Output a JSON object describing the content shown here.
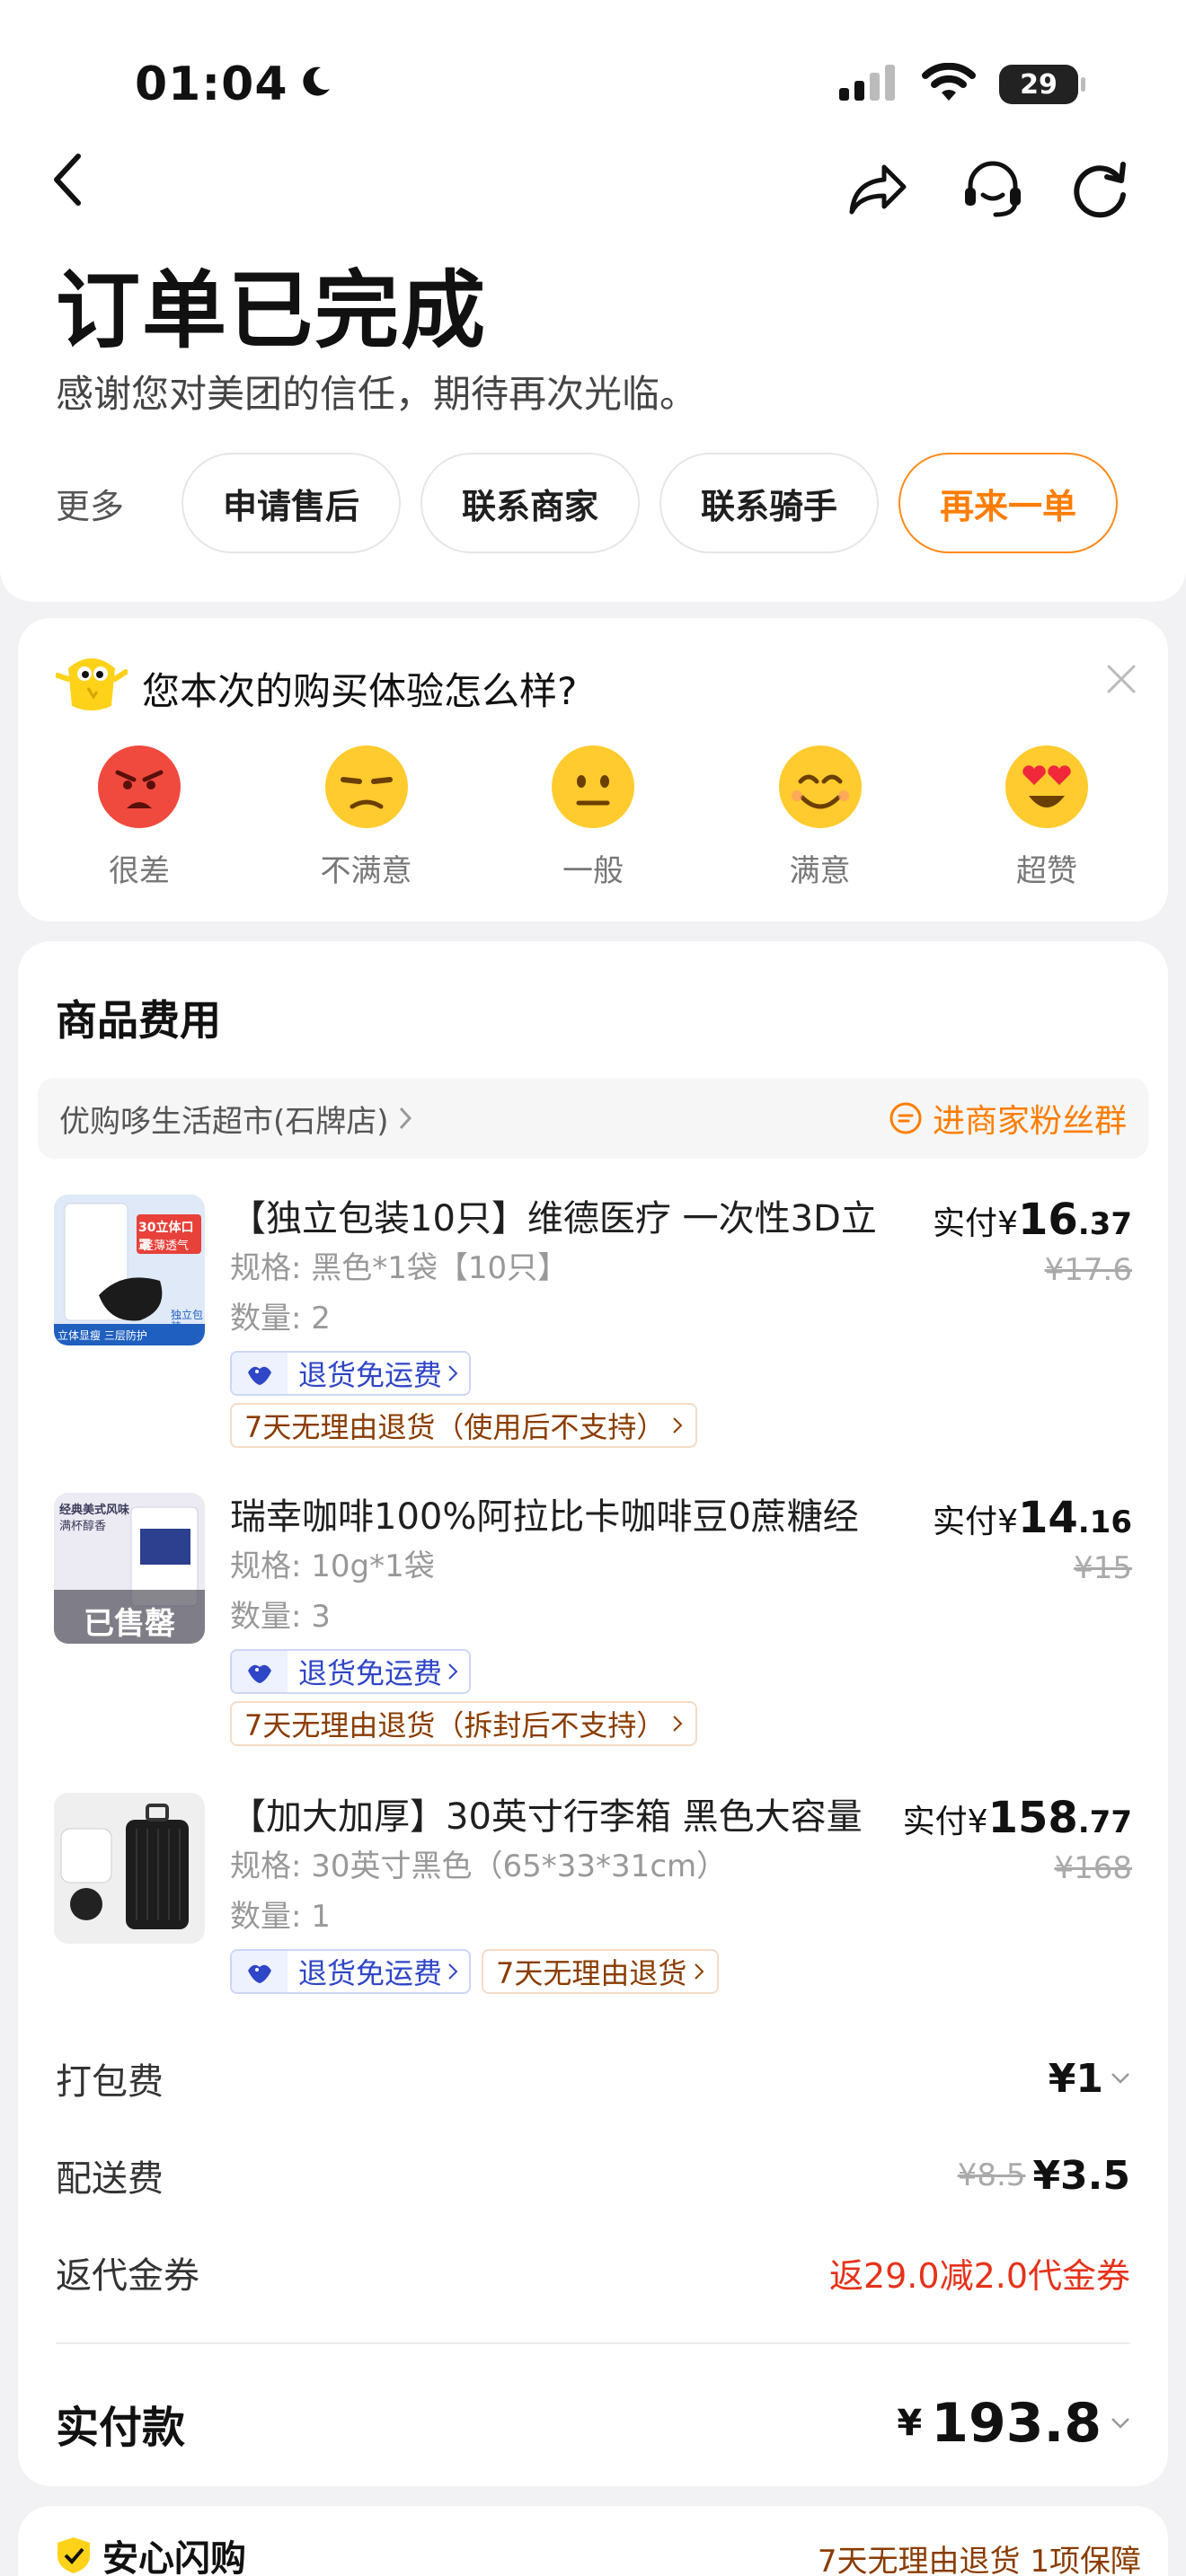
{
  "status_bar": {
    "time": "01:04",
    "battery": "29"
  },
  "header": {
    "title": "订单已完成",
    "subtitle": "感谢您对美团的信任，期待再次光临。"
  },
  "actions": {
    "more": "更多",
    "after_sale": "申请售后",
    "contact_merchant": "联系商家",
    "contact_rider": "联系骑手",
    "reorder": "再来一单"
  },
  "survey": {
    "question": "您本次的购买体验怎么样?",
    "options": [
      {
        "label": "很差",
        "icon": "angry-face-icon"
      },
      {
        "label": "不满意",
        "icon": "unamused-face-icon"
      },
      {
        "label": "一般",
        "icon": "neutral-face-icon"
      },
      {
        "label": "满意",
        "icon": "smiling-face-icon"
      },
      {
        "label": "超赞",
        "icon": "heart-eyes-face-icon"
      }
    ]
  },
  "fees_section": {
    "title": "商品费用",
    "store": "优购哆生活超市(石牌店)",
    "fan_group": "进商家粉丝群",
    "items": [
      {
        "name": "【独立包装10只】维德医疗 一次性3D立",
        "spec": "规格: 黑色*1袋【10只】",
        "qty": "数量: 2",
        "paid_label": "实付",
        "yen": "¥",
        "price_int": "16",
        "price_dec": ".37",
        "original": "¥17.6",
        "tag_free_return": "退货免运费",
        "tag_7day": "7天无理由退货（使用后不支持）",
        "thumb_text_1": "30立体口罩",
        "thumb_text_2": "轻薄透气",
        "thumb_text_3": "立体显瘦 三层防护",
        "thumb_text_4": "独立包装"
      },
      {
        "name": "瑞幸咖啡100%阿拉比卡咖啡豆0蔗糖经",
        "spec": "规格: 10g*1袋",
        "qty": "数量: 3",
        "paid_label": "实付",
        "yen": "¥",
        "price_int": "14",
        "price_dec": ".16",
        "original": "¥15",
        "tag_free_return": "退货免运费",
        "tag_7day": "7天无理由退货（拆封后不支持）",
        "thumb_text_1": "经典美式风味",
        "thumb_text_2": "满杯醇香",
        "sold_out": "已售罄"
      },
      {
        "name": "【加大加厚】30英寸行李箱 黑色大容量",
        "spec": "规格: 30英寸黑色（65*33*31cm）",
        "qty": "数量: 1",
        "paid_label": "实付",
        "yen": "¥",
        "price_int": "158",
        "price_dec": ".77",
        "original": "¥168",
        "tag_free_return": "退货免运费",
        "tag_7day": "7天无理由退货"
      }
    ],
    "packing_fee": {
      "label": "打包费",
      "value": "¥1"
    },
    "delivery_fee": {
      "label": "配送费",
      "original": "¥8.5",
      "value": "¥3.5"
    },
    "coupon": {
      "label": "返代金券",
      "value": "返29.0减2.0代金券"
    },
    "total": {
      "label": "实付款",
      "yen": "¥",
      "value": "193.8"
    }
  },
  "bottom_peek": {
    "title": "安心闪购",
    "right": "7天无理由退货 1项保障"
  },
  "colors": {
    "accent": "#ff7d00",
    "coupon_red": "#e5321a",
    "tag_blue": "#2f46c7"
  }
}
